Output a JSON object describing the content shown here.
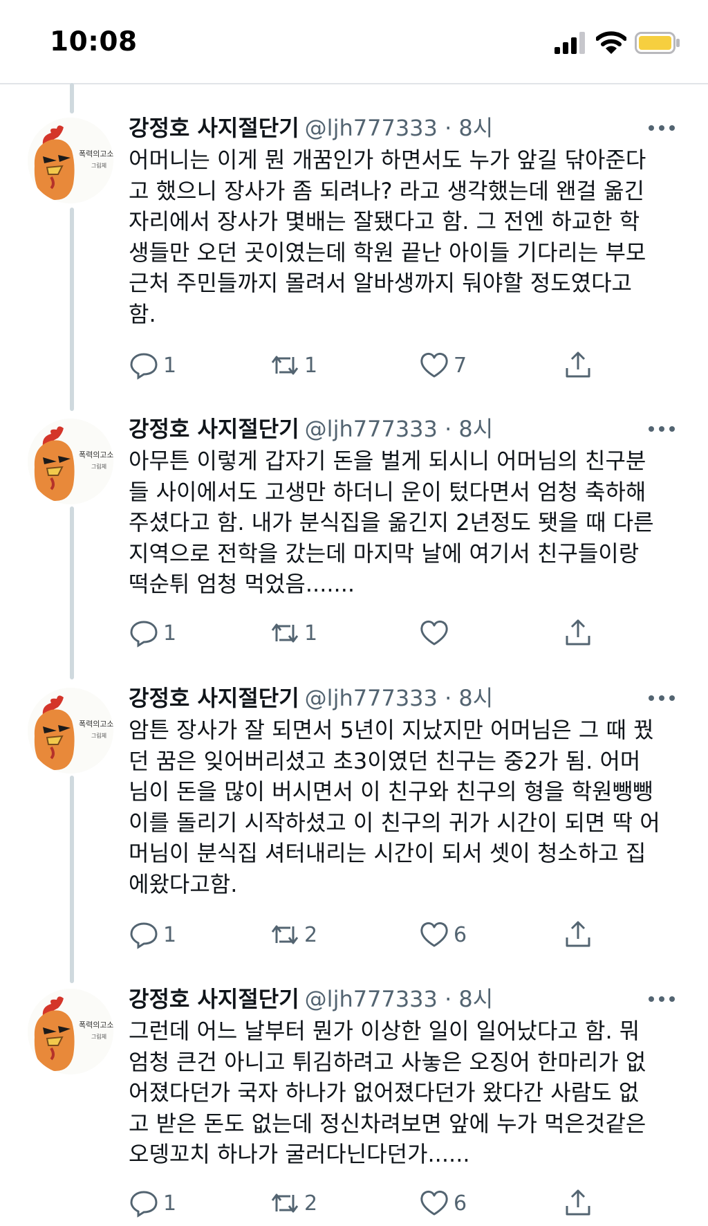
{
  "status_bar": {
    "time": "10:08"
  },
  "tweets": [
    {
      "name": "강정호 사지절단기",
      "handle": "@ljh777333 · 8시",
      "text": "어머니는 이게 뭔 개꿈인가 하면서도 누가 앞길 닦아준다\n고 했으니 장사가 좀 되려나? 라고 생각했는데 왠걸 옮긴\n자리에서 장사가 몇배는 잘됐다고 함. 그 전엔 하교한 학\n생들만 오던 곳이였는데 학원 끝난 아이들 기다리는 부모\n근처 주민들까지 몰려서 알바생까지 둬야할 정도였다고\n함.",
      "replies": "1",
      "retweets": "1",
      "likes": "7"
    },
    {
      "name": "강정호 사지절단기",
      "handle": "@ljh777333 · 8시",
      "text": "아무튼 이렇게 갑자기 돈을 벌게 되시니 어머님의 친구분\n들 사이에서도 고생만 하더니 운이 텄다면서 엄청 축하해\n주셨다고 함. 내가 분식집을 옮긴지 2년정도 됏을 때 다른\n지역으로 전학을 갔는데 마지막 날에 여기서 친구들이랑\n떡순튀 엄청 먹었음.......",
      "replies": "1",
      "retweets": "1",
      "likes": ""
    },
    {
      "name": "강정호 사지절단기",
      "handle": "@ljh777333 · 8시",
      "text": "암튼 장사가 잘 되면서 5년이 지났지만 어머님은 그 때 꿨\n던 꿈은 잊어버리셨고 초3이였던 친구는 중2가 됨. 어머\n님이 돈을 많이 버시면서 이 친구와 친구의 형을 학원뺑뺑\n이를 돌리기 시작하셨고 이 친구의 귀가 시간이 되면 딱 어\n머님이 분식집 셔터내리는 시간이 되서 셋이 청소하고 집\n에왔다고함.",
      "replies": "1",
      "retweets": "2",
      "likes": "6"
    },
    {
      "name": "강정호 사지절단기",
      "handle": "@ljh777333 · 8시",
      "text": "그런데 어느 날부터 뭔가 이상한 일이 일어났다고 함. 뭐\n엄청 큰건 아니고 튀김하려고 사놓은 오징어 한마리가 없\n어졌다던가 국자 하나가 없어졌다던가 왔다간 사람도 없\n고 받은 돈도 없는데 정신차려보면 앞에 누가 먹은것같은\n오뎅꼬치 하나가 굴러다닌다던가......",
      "replies": "1",
      "retweets": "2",
      "likes": "6"
    }
  ]
}
